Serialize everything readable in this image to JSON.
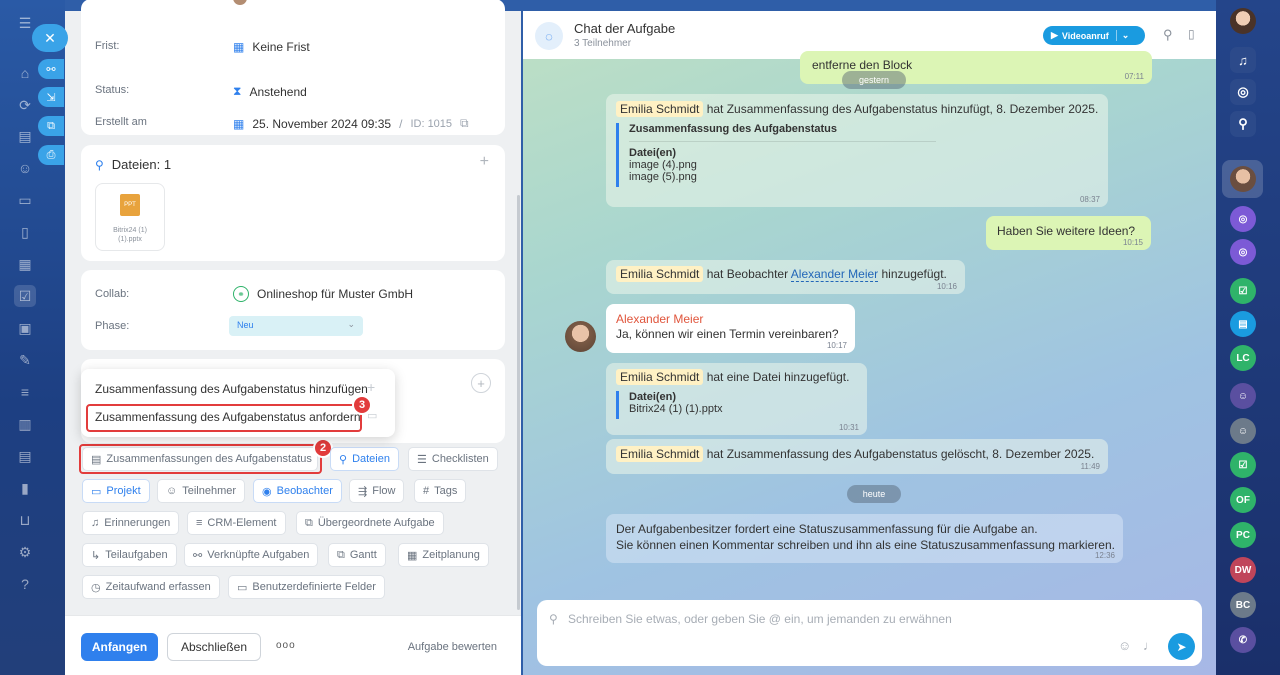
{
  "left_panel": {
    "fields": [
      {
        "label": "Frist:",
        "value": "Keine Frist"
      },
      {
        "label": "Status:",
        "value": "Anstehend"
      },
      {
        "label": "Erstellt am",
        "value": "25. November 2024 09:35",
        "id_label": "ID: 1015"
      }
    ],
    "files_card": {
      "title": "Dateien: 1",
      "file_name": "Bitrix24 (1) (1).pptx"
    },
    "collab": {
      "label": "Collab:",
      "value": "Onlineshop für Muster GmbH"
    },
    "phase": {
      "label": "Phase:",
      "value": "Neu"
    },
    "popup": {
      "item_add": "Zusammenfassung des Aufgabenstatus hinzufügen",
      "item_request": "Zusammenfassung des Aufgabenstatus anfordern"
    },
    "chips": [
      "Zusammenfassungen des Aufgabenstatus",
      "Dateien",
      "Checklisten",
      "Projekt",
      "Teilnehmer",
      "Beobachter",
      "Flow",
      "Tags",
      "Erinnerungen",
      "CRM-Element",
      "Übergeordnete Aufgabe",
      "Teilaufgaben",
      "Verknüpfte Aufgaben",
      "Gantt",
      "Zeitplanung",
      "Zeitaufwand erfassen",
      "Benutzerdefinierte Felder"
    ],
    "badges": [
      "2",
      "3"
    ],
    "bottom": {
      "start": "Anfangen",
      "finish": "Abschließen",
      "more": "ooo",
      "rate": "Aufgabe bewerten"
    }
  },
  "chat": {
    "title": "Chat der Aufgabe",
    "subtitle": "3 Teilnehmer",
    "video_button": "Videoanruf",
    "messages": {
      "m0_text": "entferne den Block",
      "m0_time": "07:11",
      "day_yesterday": "gestern",
      "m1_name": "Emilia Schmidt",
      "m1_text": "hat Zusammenfassung des Aufgabenstatus hinzufügt, 8. Dezember 2025.",
      "m1_quote_title": "Zusammenfassung des Aufgabenstatus",
      "m1_files_title": "Datei(en)",
      "m1_file1": "image (4).png",
      "m1_file2": "image (5).png",
      "m1_time": "08:37",
      "m2_text": "Haben Sie weitere Ideen?",
      "m2_time": "10:15",
      "m3_name": "Emilia Schmidt",
      "m3_text": "hat Beobachter",
      "m3_link": "Alexander Meier",
      "m3_text2": "hinzugefügt.",
      "m3_time": "10:16",
      "m4_author": "Alexander Meier",
      "m4_text": "Ja, können wir einen Termin vereinbaren?",
      "m4_time": "10:17",
      "m5_name": "Emilia Schmidt",
      "m5_text": "hat eine Datei hinzugefügt.",
      "m5_files_title": "Datei(en)",
      "m5_file": "Bitrix24 (1) (1).pptx",
      "m5_time": "10:31",
      "m6_name": "Emilia Schmidt",
      "m6_text": "hat Zusammenfassung des Aufgabenstatus gelöscht, 8. Dezember 2025.",
      "m6_time": "11:49",
      "day_today": "heute",
      "m7_line1": "Der Aufgabenbesitzer fordert eine Statuszusammenfassung für die Aufgabe an.",
      "m7_line2": "Sie können einen Kommentar schreiben und ihn als eine Statuszusammenfassung markieren.",
      "m7_time": "12:36"
    },
    "composer_placeholder": "Schreiben Sie etwas, oder geben Sie @ ein, um jemanden zu erwähnen"
  },
  "right_sidebar": {
    "initials": [
      "LC",
      "OF",
      "PC",
      "DW",
      "BC"
    ]
  },
  "colors": {
    "accent": "#2f80ed",
    "highlight": "#e23c3c",
    "my_bubble": "#dcf5b5"
  }
}
